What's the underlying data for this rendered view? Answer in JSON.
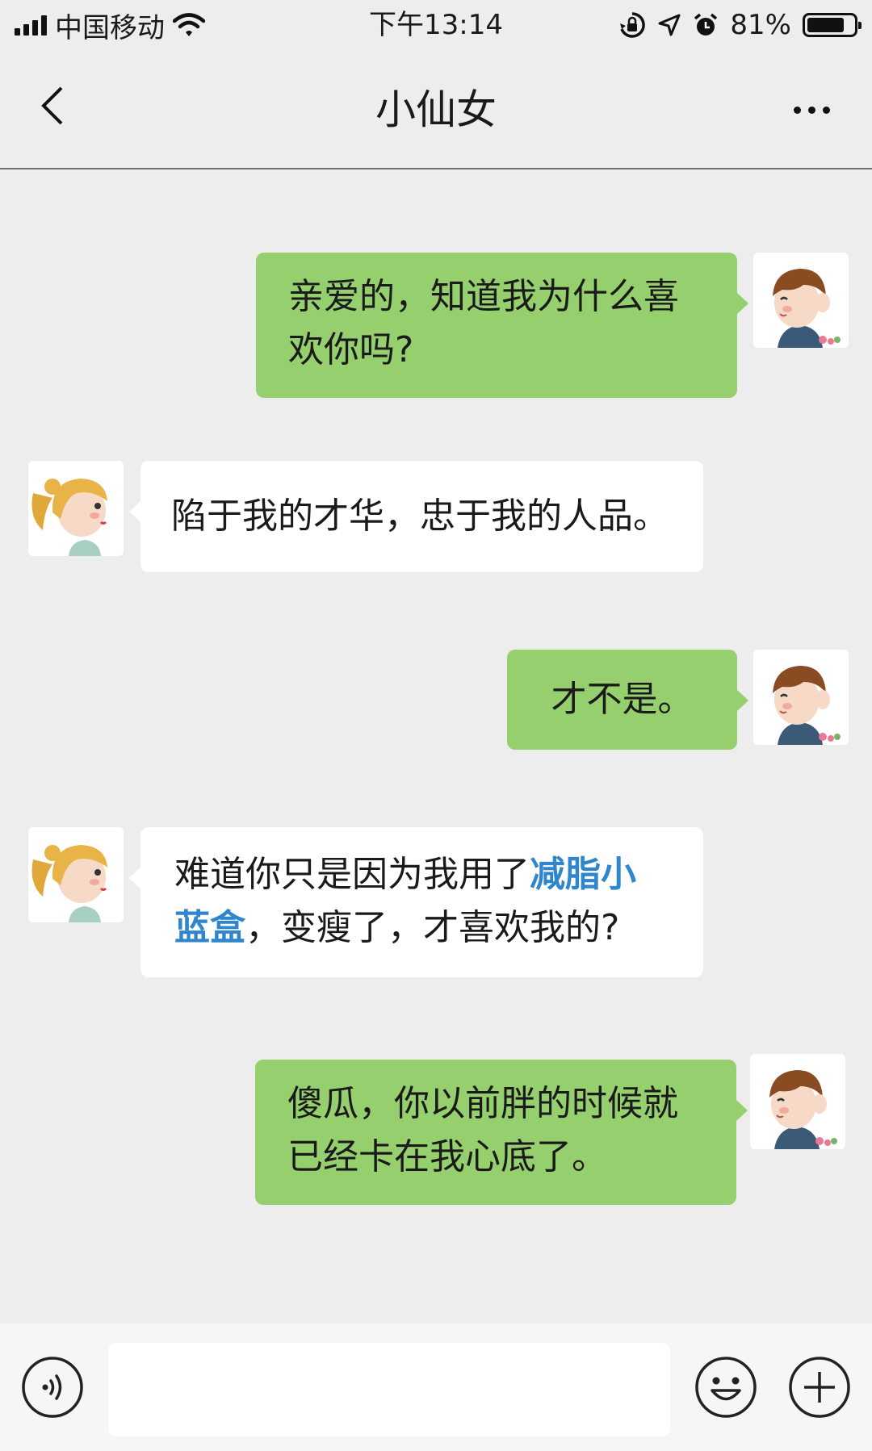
{
  "status_bar": {
    "carrier": "中国移动",
    "time": "下午13:14",
    "battery_percent": "81%",
    "battery_level": 0.81
  },
  "nav": {
    "title": "小仙女",
    "back_icon": "chevron-left-icon",
    "more_icon": "more-horizontal-icon"
  },
  "messages": [
    {
      "side": "out",
      "text": "亲爱的，知道我为什么喜欢你吗?",
      "line1": "亲爱的，知道我为什么喜",
      "line2": "欢你吗?"
    },
    {
      "side": "in",
      "text": "陷于我的才华，忠于我的人品。"
    },
    {
      "side": "out",
      "text": "才不是。"
    },
    {
      "side": "in",
      "part1": "难道你只是因为我用了",
      "link": "减脂小蓝盒",
      "link_line1": "减脂小",
      "link_line2": "蓝盒",
      "part2": "，变瘦了，才喜欢我的?"
    },
    {
      "side": "out",
      "text": "傻瓜，你以前胖的时候就已经卡在我心底了。",
      "line1": "傻瓜，你以前胖的时候就",
      "line2": "已经卡在我心底了。"
    }
  ],
  "input_bar": {
    "voice_icon": "voice-icon",
    "emoji_icon": "emoji-icon",
    "plus_icon": "plus-circle-icon",
    "input_value": ""
  },
  "colors": {
    "background": "#ededed",
    "outgoing_bubble": "#95cf6e",
    "incoming_bubble": "#ffffff",
    "link": "#2f86cc"
  }
}
